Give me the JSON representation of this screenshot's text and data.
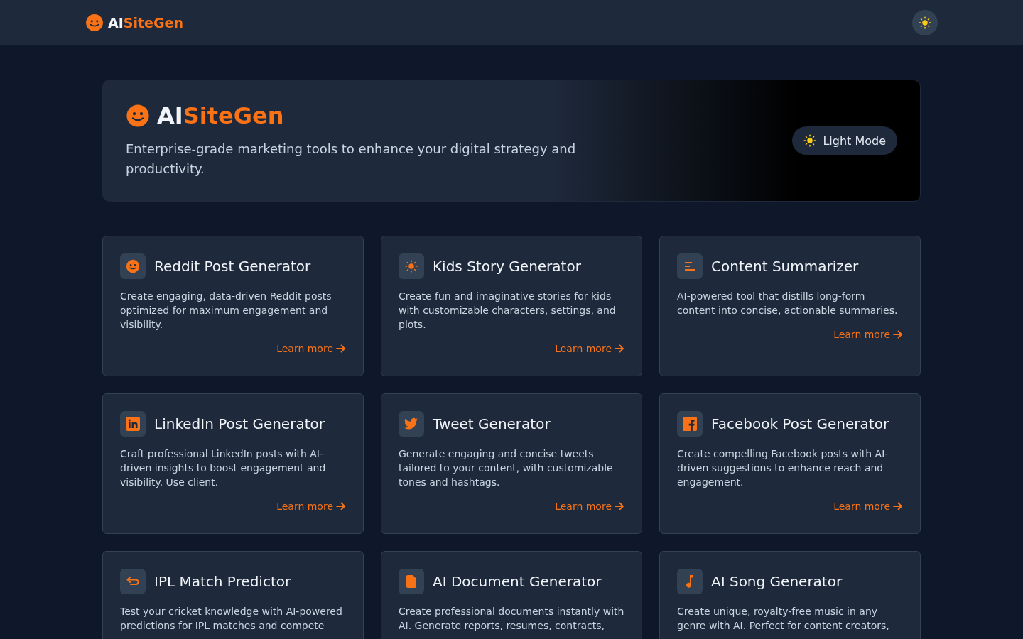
{
  "header": {
    "brand": {
      "prefix": "AI",
      "suffix": "SiteGen"
    }
  },
  "hero": {
    "brand": {
      "prefix": "AI",
      "suffix": "SiteGen"
    },
    "subtitle": "Enterprise-grade marketing tools to enhance your digital strategy and productivity.",
    "mode_button": "Light Mode"
  },
  "tools": [
    {
      "kind": "smile",
      "title": "Reddit Post Generator",
      "description": "Create engaging, data-driven Reddit posts optimized for maximum engagement and visibility.",
      "link": "Learn more"
    },
    {
      "kind": "sun",
      "title": "Kids Story Generator",
      "description": "Create fun and imaginative stories for kids with customizable characters, settings, and plots.",
      "link": "Learn more"
    },
    {
      "kind": "lines",
      "title": "Content Summarizer",
      "description": "AI-powered tool that distills long-form content into concise, actionable summaries.",
      "link": "Learn more"
    },
    {
      "kind": "linkedin",
      "title": "LinkedIn Post Generator",
      "description": "Craft professional LinkedIn posts with AI-driven insights to boost engagement and visibility. Use client.",
      "link": "Learn more"
    },
    {
      "kind": "bird",
      "title": "Tweet Generator",
      "description": "Generate engaging and concise tweets tailored to your content, with customizable tones and hashtags.",
      "link": "Learn more"
    },
    {
      "kind": "facebook",
      "title": "Facebook Post Generator",
      "description": "Create compelling Facebook posts with AI-driven suggestions to enhance reach and engagement.",
      "link": "Learn more"
    },
    {
      "kind": "swap",
      "title": "IPL Match Predictor",
      "description": "Test your cricket knowledge with AI-powered predictions for IPL matches and compete"
    },
    {
      "kind": "document",
      "title": "AI Document Generator",
      "description": "Create professional documents instantly with AI. Generate reports, resumes, contracts,"
    },
    {
      "kind": "note",
      "title": "AI Song Generator",
      "description": "Create unique, royalty-free music in any genre with AI. Perfect for content creators,"
    }
  ]
}
